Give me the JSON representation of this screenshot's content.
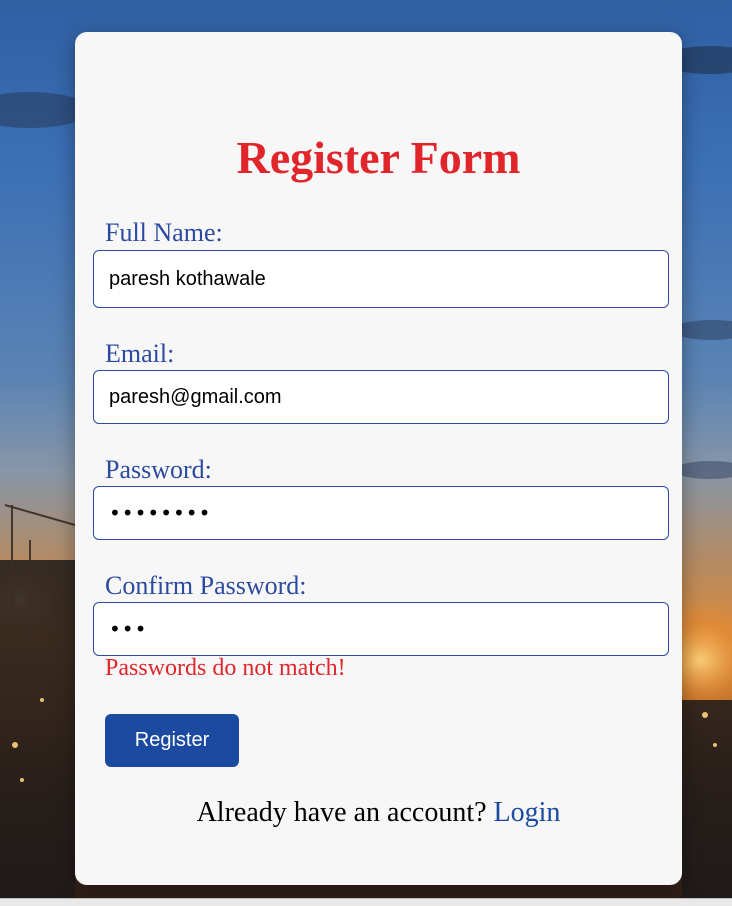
{
  "form": {
    "title": "Register Form",
    "full_name_label": "Full Name:",
    "full_name_value": "paresh kothawale",
    "email_label": "Email:",
    "email_value": "paresh@gmail.com",
    "password_label": "Password:",
    "password_masked": "••••••••",
    "confirm_password_label": "Confirm Password:",
    "confirm_password_masked": "•••",
    "error_message": "Passwords do not match!",
    "register_button_label": "Register",
    "footer_text": "Already have an account? ",
    "login_link_label": "Login"
  },
  "colors": {
    "title": "#e0262b",
    "label": "#2b4aa0",
    "error": "#e0262b",
    "button": "#1b4aa0",
    "card_background": "#f7f7f8"
  }
}
